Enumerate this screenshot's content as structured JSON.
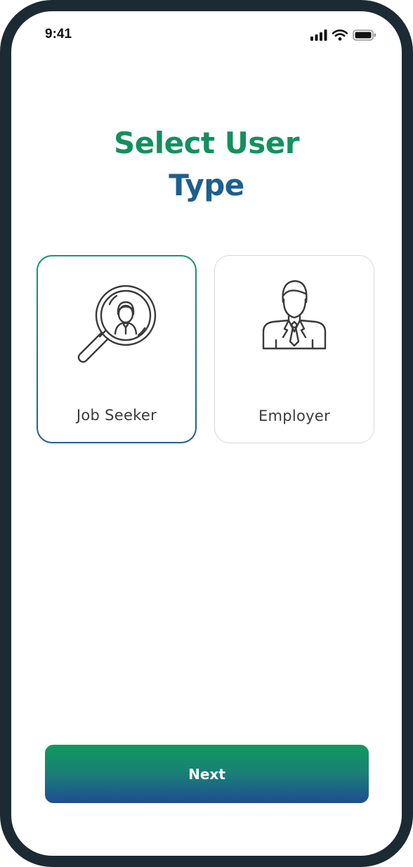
{
  "status_bar": {
    "time": "9:41",
    "icons": [
      "signal-bars-icon",
      "wifi-icon",
      "battery-icon"
    ]
  },
  "header": {
    "title_line1": "Select User",
    "title_line2": "Type"
  },
  "user_types": [
    {
      "label": "Job Seeker",
      "icon": "job-seeker-search-icon",
      "selected": true
    },
    {
      "label": "Employer",
      "icon": "employer-person-icon",
      "selected": false
    }
  ],
  "actions": {
    "next_label": "Next"
  },
  "colors": {
    "frame": "#1c2a33",
    "title_green": "#13905e",
    "title_blue": "#1d5f8e",
    "button_gradient_top": "#0f9a5c",
    "button_gradient_bottom": "#1f4c92",
    "card_border_inactive": "#d9d9d9"
  }
}
